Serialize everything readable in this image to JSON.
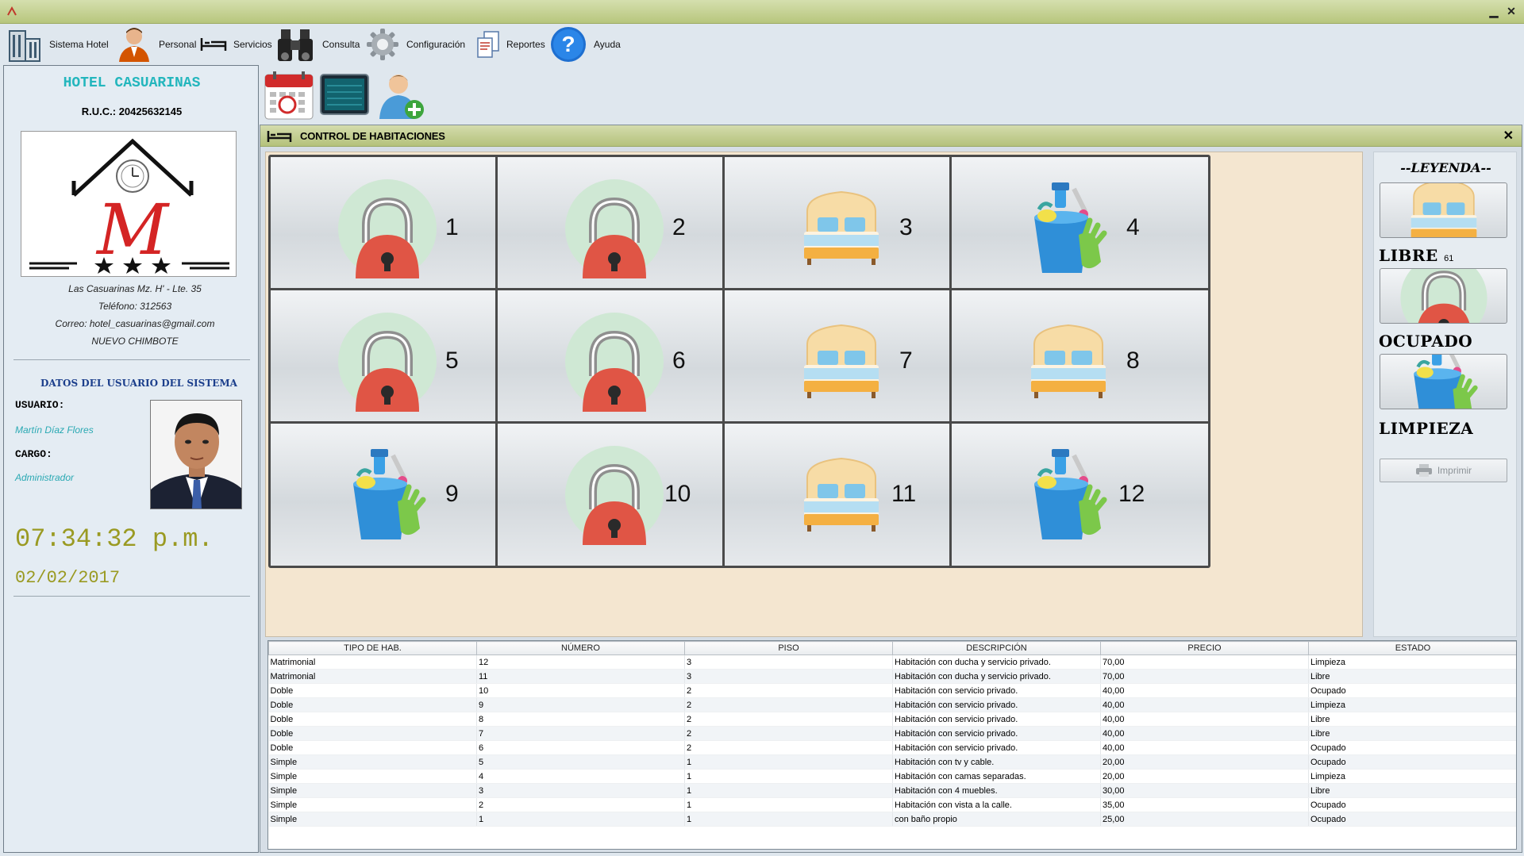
{
  "window": {
    "minimize": "▁",
    "close": "✕"
  },
  "menu": [
    {
      "label": "Sistema Hotel",
      "icon": "building-icon"
    },
    {
      "label": "Personal",
      "icon": "person-icon"
    },
    {
      "label": "Servicios",
      "icon": "bed-icon"
    },
    {
      "label": "Consulta",
      "icon": "binoculars-icon"
    },
    {
      "label": "Configuración",
      "icon": "gear-icon"
    },
    {
      "label": "Reportes",
      "icon": "report-icon"
    },
    {
      "label": "Ayuda",
      "icon": "help-icon"
    }
  ],
  "sidebar": {
    "hotel_name": "HOTEL CASUARINAS",
    "ruc": "R.U.C.: 20425632145",
    "logo_letter": "M",
    "address": "Las Casuarinas Mz. H' - Lte. 35",
    "phone": "Teléfono: 312563",
    "email": "Correo: hotel_casuarinas@gmail.com",
    "city": "NUEVO CHIMBOTE",
    "user_section_title": "DATOS DEL USUARIO DEL SISTEMA",
    "user_label": "USUARIO:",
    "user_value": "Martín Díaz Flores",
    "role_label": "CARGO:",
    "role_value": "Administrador",
    "time": "07:34:32 p.m.",
    "date": "02/02/2017"
  },
  "control": {
    "title": "CONTROL DE HABITACIONES",
    "close": "✕",
    "rooms": [
      {
        "num": "1",
        "state": "ocupado"
      },
      {
        "num": "2",
        "state": "ocupado"
      },
      {
        "num": "3",
        "state": "libre"
      },
      {
        "num": "4",
        "state": "limpieza"
      },
      {
        "num": "5",
        "state": "ocupado"
      },
      {
        "num": "6",
        "state": "ocupado"
      },
      {
        "num": "7",
        "state": "libre"
      },
      {
        "num": "8",
        "state": "libre"
      },
      {
        "num": "9",
        "state": "limpieza"
      },
      {
        "num": "10",
        "state": "ocupado"
      },
      {
        "num": "11",
        "state": "libre"
      },
      {
        "num": "12",
        "state": "limpieza"
      }
    ]
  },
  "legend": {
    "title": "--LEYENDA--",
    "libre": "LIBRE",
    "libre_count": "61",
    "ocupado": "OCUPADO",
    "limpieza": "LIMPIEZA",
    "print": "Imprimir"
  },
  "table": {
    "headers": [
      "TIPO DE HAB.",
      "NÚMERO",
      "PISO",
      "DESCRIPCIÓN",
      "PRECIO",
      "ESTADO"
    ],
    "rows": [
      [
        "Matrimonial",
        "12",
        "3",
        "Habitación con ducha y servicio privado.",
        "70,00",
        "Limpieza"
      ],
      [
        "Matrimonial",
        "11",
        "3",
        "Habitación con ducha y servicio privado.",
        "70,00",
        "Libre"
      ],
      [
        "Doble",
        "10",
        "2",
        "Habitación con servicio privado.",
        "40,00",
        "Ocupado"
      ],
      [
        "Doble",
        "9",
        "2",
        "Habitación con servicio privado.",
        "40,00",
        "Limpieza"
      ],
      [
        "Doble",
        "8",
        "2",
        "Habitación con servicio privado.",
        "40,00",
        "Libre"
      ],
      [
        "Doble",
        "7",
        "2",
        "Habitación con servicio privado.",
        "40,00",
        "Libre"
      ],
      [
        "Doble",
        "6",
        "2",
        "Habitación con servicio privado.",
        "40,00",
        "Ocupado"
      ],
      [
        "Simple",
        "5",
        "1",
        "Habitación con tv y cable.",
        "20,00",
        "Ocupado"
      ],
      [
        "Simple",
        "4",
        "1",
        "Habitación con camas separadas.",
        "20,00",
        "Limpieza"
      ],
      [
        "Simple",
        "3",
        "1",
        "Habitación con 4 muebles.",
        "30,00",
        "Libre"
      ],
      [
        "Simple",
        "2",
        "1",
        "Habitación con vista a la calle.",
        "35,00",
        "Ocupado"
      ],
      [
        "Simple",
        "1",
        "1",
        "con baño propio",
        "25,00",
        "Ocupado"
      ]
    ]
  }
}
